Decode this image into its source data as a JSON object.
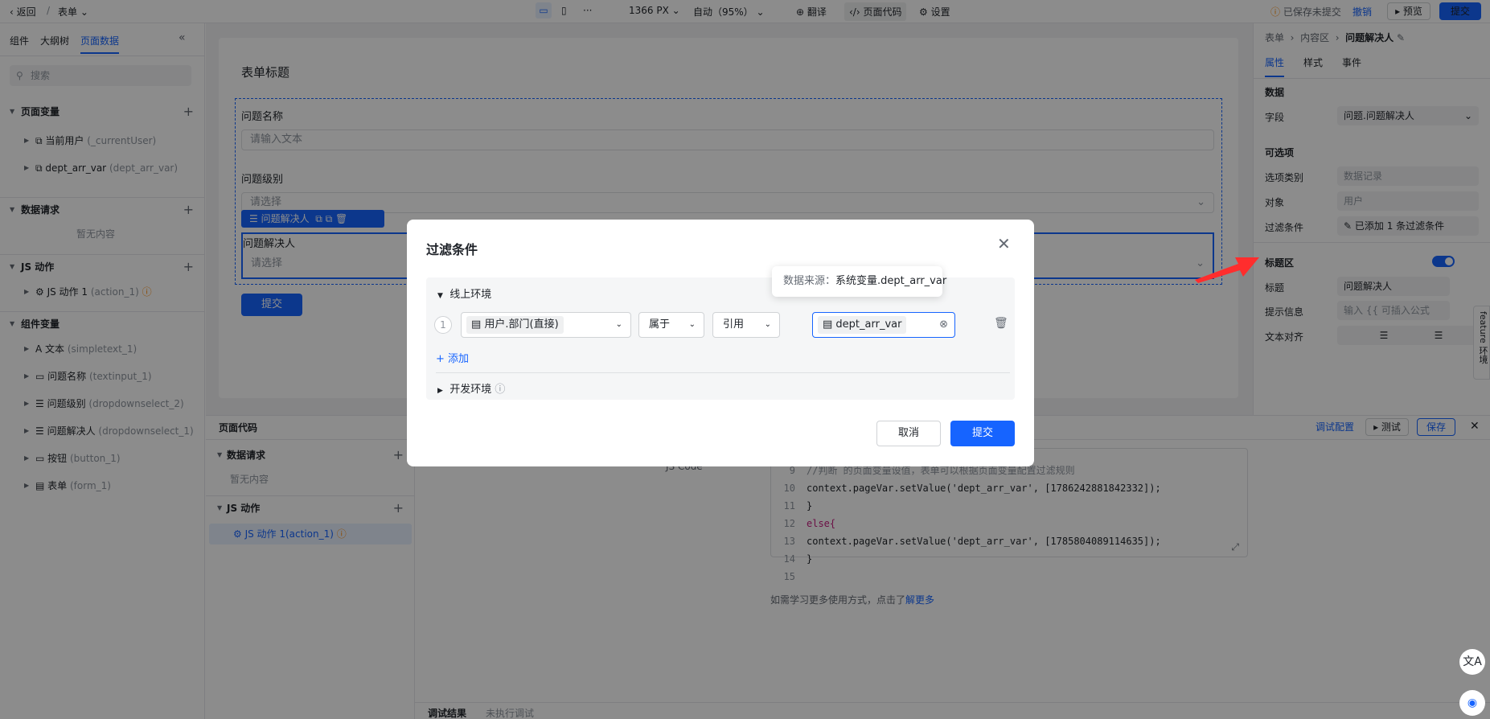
{
  "topbar": {
    "back": "返回",
    "form_name": "表单",
    "resolution": "1366 PX",
    "zoom": "自动（95%）",
    "translate": "翻译",
    "page_code": "页面代码",
    "settings": "设置",
    "unsaved": "已保存未提交",
    "undo": "撤销",
    "preview": "预览",
    "submit": "提交"
  },
  "left": {
    "tabs": [
      "组件",
      "大纲树",
      "页面数据"
    ],
    "search_placeholder": "搜索",
    "page_vars_title": "页面变量",
    "page_vars": [
      {
        "name": "当前用户",
        "sub": "(_currentUser)"
      },
      {
        "name": "dept_arr_var",
        "sub": "(dept_arr_var)"
      }
    ],
    "data_req_title": "数据请求",
    "empty": "暂无内容",
    "js_title": "JS 动作",
    "js_items": [
      {
        "name": "JS 动作 1",
        "sub": "(action_1)"
      }
    ],
    "comp_title": "组件变量",
    "comps": [
      {
        "name": "文本",
        "sub": "(simpletext_1)"
      },
      {
        "name": "问题名称",
        "sub": "(textinput_1)"
      },
      {
        "name": "问题级别",
        "sub": "(dropdownselect_2)"
      },
      {
        "name": "问题解决人",
        "sub": "(dropdownselect_1)"
      },
      {
        "name": "按钮",
        "sub": "(button_1)"
      },
      {
        "name": "表单",
        "sub": "(form_1)"
      }
    ]
  },
  "canvas": {
    "form_title": "表单标题",
    "q_name": "问题名称",
    "q_name_ph": "请输入文本",
    "q_level": "问题级别",
    "q_level_ph": "请选择",
    "toolbar_label": "问题解决人",
    "q_solver": "问题解决人",
    "q_solver_ph": "请选择",
    "submit": "提交"
  },
  "right": {
    "crumbs": [
      "表单",
      "内容区",
      "问题解决人"
    ],
    "tabs": [
      "属性",
      "样式",
      "事件"
    ],
    "data_title": "数据",
    "field_label": "字段",
    "field_value": "问题.问题解决人",
    "options_title": "可选项",
    "opt_type_label": "选项类别",
    "opt_type_value": "数据记录",
    "object_label": "对象",
    "object_value": "用户",
    "filter_label": "过滤条件",
    "filter_value": "已添加 1 条过滤条件",
    "title_area": "标题区",
    "title_label": "标题",
    "title_value": "问题解决人",
    "hint_label": "提示信息",
    "hint_ph": "输入 {{ 可插入公式",
    "align_label": "文本对齐",
    "feature_tab": "feature 环境"
  },
  "code": {
    "title": "页面代码",
    "data_req": "数据请求",
    "empty": "暂无内容",
    "js": "JS 动作",
    "js_item": "JS 动作 1(action_1)",
    "debug_cfg": "调试配置",
    "test": "测试",
    "save": "保存",
    "js_code_label": "JS Code",
    "lines": [
      {
        "n": "9",
        "t": "//判断 的页面变量设值，表单可以根据页面变量配置过滤规则"
      },
      {
        "n": "10",
        "t": "context.pageVar.setValue('dept_arr_var', [1786242881842332]);"
      },
      {
        "n": "11",
        "t": "}"
      },
      {
        "n": "12",
        "t": "else{"
      },
      {
        "n": "13",
        "t": "context.pageVar.setValue('dept_arr_var', [1785804089114635]);"
      },
      {
        "n": "14",
        "t": "}"
      },
      {
        "n": "15",
        "t": ""
      }
    ],
    "learn": "如需学习更多使用方式，点击了",
    "learn_link": "解更多",
    "result_tab": "调试结果",
    "not_run": "未执行调试"
  },
  "modal": {
    "title": "过滤条件",
    "env_online": "线上环境",
    "row_index": "1",
    "field": "用户.部门(直接)",
    "op": "属于",
    "mode": "引用",
    "value": "dept_arr_var",
    "tooltip_label": "数据来源：",
    "tooltip_value": "系统变量.dept_arr_var",
    "add": "添加",
    "env_dev": "开发环境",
    "cancel": "取消",
    "submit": "提交"
  }
}
